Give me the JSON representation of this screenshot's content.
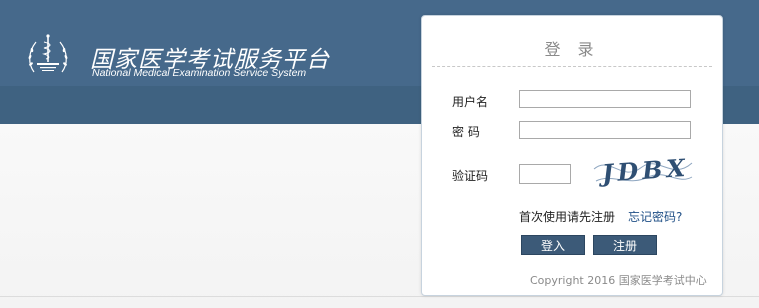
{
  "header": {
    "title": "国家医学考试服务平台",
    "subtitle": "National Medical Examination Service System",
    "logo_icon": "medical-emblem-icon"
  },
  "login": {
    "title": "登 录",
    "username_label": "用户名",
    "password_label": "密 码",
    "captcha_label": "验证码",
    "username_value": "",
    "password_value": "",
    "captcha_value": "",
    "captcha_text": "JDBX",
    "first_use_text": "首次使用请先注册",
    "forgot_link": "忘记密码?",
    "login_button": "登入",
    "register_button": "注册",
    "copyright": "Copyright 2016 国家医学考试中心"
  },
  "colors": {
    "header_bg": "#46698b",
    "header_lower": "#3f6281",
    "button_bg": "#3c5a78",
    "link": "#1f4f86",
    "captcha_ink": "#2f4f73"
  }
}
